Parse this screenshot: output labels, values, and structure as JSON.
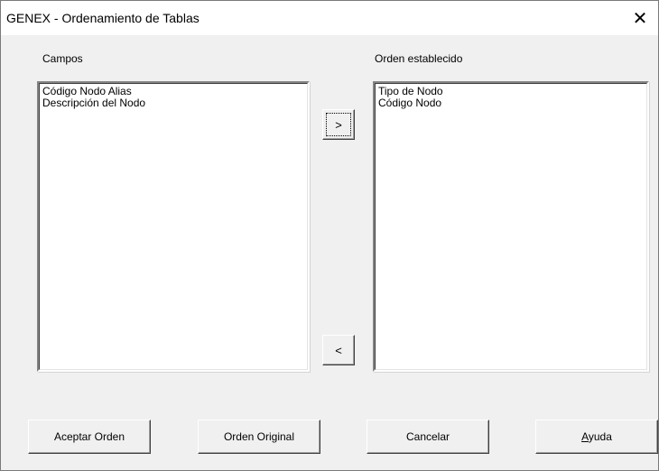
{
  "window": {
    "title": "GENEX - Ordenamiento de Tablas",
    "close_glyph": "✕"
  },
  "fields_panel": {
    "label": "Campos",
    "items": [
      "Código Nodo Alias",
      "Descripción del Nodo"
    ]
  },
  "order_panel": {
    "label": "Orden establecido",
    "items": [
      "Tipo de Nodo",
      "Código Nodo"
    ]
  },
  "move_buttons": {
    "add_label": ">",
    "remove_label": "<"
  },
  "footer_buttons": {
    "accept_label": "Aceptar Orden",
    "original_label": "Orden Original",
    "cancel_label": "Cancelar",
    "help_label_rest": "yuda",
    "help_label_mnemonic": "A"
  }
}
